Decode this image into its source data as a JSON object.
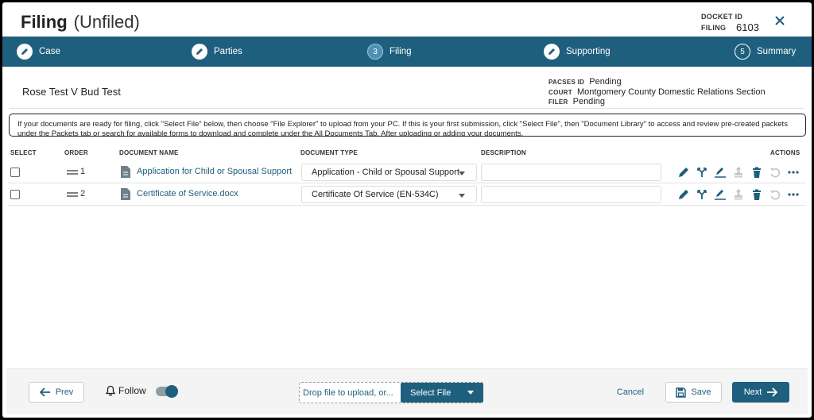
{
  "header": {
    "title": "Filing",
    "subtitle": "(Unfiled)",
    "docket_id_label": "DOCKET ID",
    "filing_label": "FILING",
    "filing_value": "6103"
  },
  "steps": [
    {
      "label": "Case",
      "state": "done"
    },
    {
      "label": "Parties",
      "state": "done"
    },
    {
      "label": "Filing",
      "number": "3",
      "state": "active"
    },
    {
      "label": "Supporting",
      "state": "done"
    },
    {
      "label": "Summary",
      "number": "5",
      "state": "pending"
    }
  ],
  "case": {
    "name": "Rose Test V Bud Test",
    "pacses_id_label": "PACSES ID",
    "pacses_id_value": "Pending",
    "court_label": "COURT",
    "court_value": "Montgomery County Domestic Relations Section",
    "filer_label": "FILER",
    "filer_value": "Pending"
  },
  "notice": "If your documents are ready for filing, click \"Select File\" below, then choose \"File Explorer\" to upload from your PC. If this is your first submission, click \"Select File\", then \"Document Library\" to access and review pre-created packets under the Packets tab or search for available forms to download and complete under the All Documents Tab. After uploading or adding your documents,",
  "table": {
    "columns": {
      "select": "SELECT",
      "order": "ORDER",
      "document_name": "DOCUMENT NAME",
      "document_type": "DOCUMENT TYPE",
      "description": "DESCRIPTION",
      "actions": "ACTIONS"
    },
    "rows": [
      {
        "order": "1",
        "name": "Application for Child or Spousal Support",
        "type": "Application - Child or Spousal Support",
        "description": ""
      },
      {
        "order": "2",
        "name": "Certificate of Service.docx",
        "type": "Certificate Of Service (EN-534C)",
        "description": ""
      }
    ]
  },
  "footer": {
    "prev": "Prev",
    "follow": "Follow",
    "follow_on": true,
    "drop_text": "Drop file to upload, or...",
    "select_file": "Select File",
    "cancel": "Cancel",
    "save": "Save",
    "next": "Next"
  },
  "colors": {
    "primary": "#1f5f7e",
    "active_step": "#4e90b5"
  }
}
